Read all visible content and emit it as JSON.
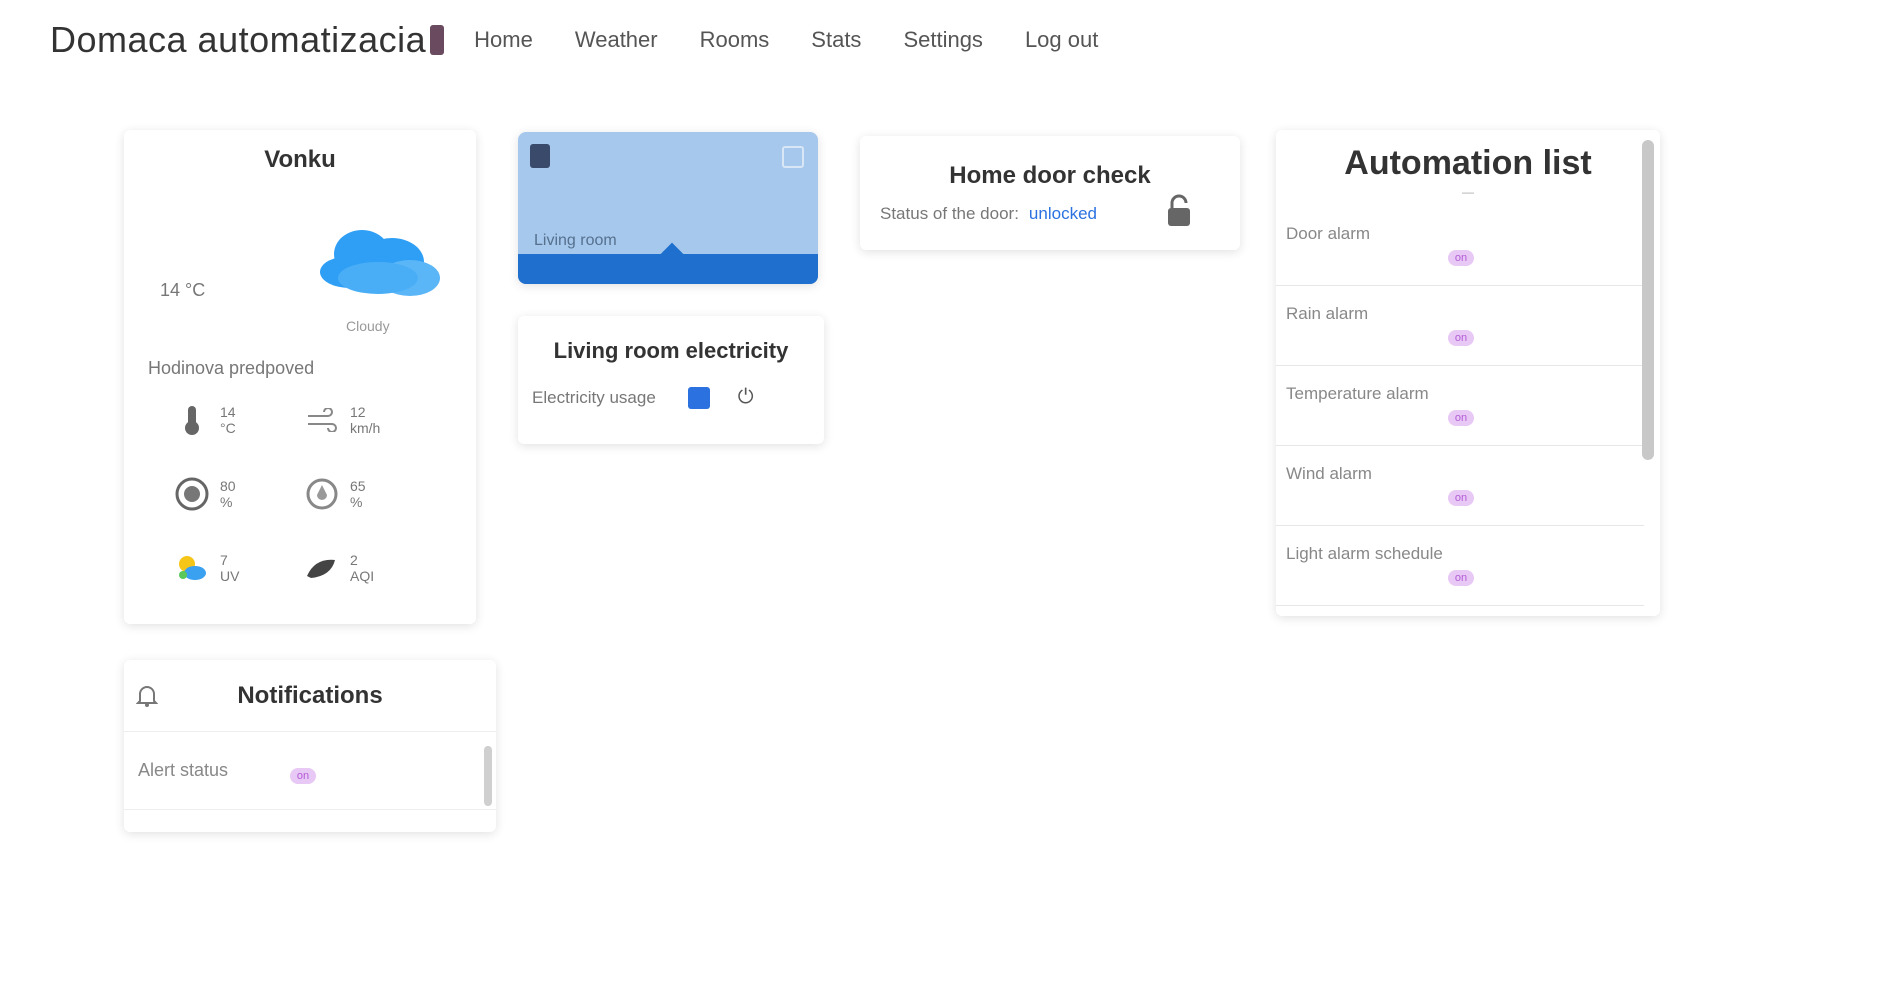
{
  "header": {
    "brand": "Domaca automatizacia",
    "nav": [
      "Home",
      "Weather",
      "Rooms",
      "Stats",
      "Settings",
      "Log out"
    ]
  },
  "forecast": {
    "title": "Vonku",
    "current_temp": "14 °C",
    "condition": "Cloudy",
    "section_label": "Hodinova predpoved",
    "items": [
      {
        "icon": "thermometer-icon",
        "line1": "14",
        "line2": "°C"
      },
      {
        "icon": "wind-icon",
        "line1": "12",
        "line2": "km/h"
      },
      {
        "icon": "cloud-icon",
        "line1": "80",
        "line2": "%"
      },
      {
        "icon": "humidity-icon",
        "line1": "65",
        "line2": "%"
      },
      {
        "icon": "sun-icon",
        "line1": "7",
        "line2": "UV"
      },
      {
        "icon": "leaf-icon",
        "line1": "2",
        "line2": "AQI"
      }
    ]
  },
  "notifications": {
    "title": "Notifications",
    "items": [
      {
        "label": "Alert status",
        "pill": "on"
      }
    ]
  },
  "camera": {
    "label": "Living room"
  },
  "electricity": {
    "title": "Living room electricity",
    "label": "Electricity usage",
    "power_symbol": "⏻"
  },
  "door": {
    "title": "Home door check",
    "status_label": "Status of the door:",
    "status_value": "unlocked"
  },
  "automation": {
    "title": "Automation list",
    "subtitle": "—",
    "items": [
      {
        "label": "Door alarm",
        "pill": "on"
      },
      {
        "label": "Rain alarm",
        "pill": "on"
      },
      {
        "label": "Temperature alarm",
        "pill": "on"
      },
      {
        "label": "Wind alarm",
        "pill": "on"
      },
      {
        "label": "Light alarm schedule",
        "pill": "on"
      }
    ]
  },
  "colors": {
    "accent": "#1f6fcf",
    "camera_bg": "#a6c8ec",
    "pill": "#e8c8f4",
    "cloud": "#2f9ff5"
  }
}
